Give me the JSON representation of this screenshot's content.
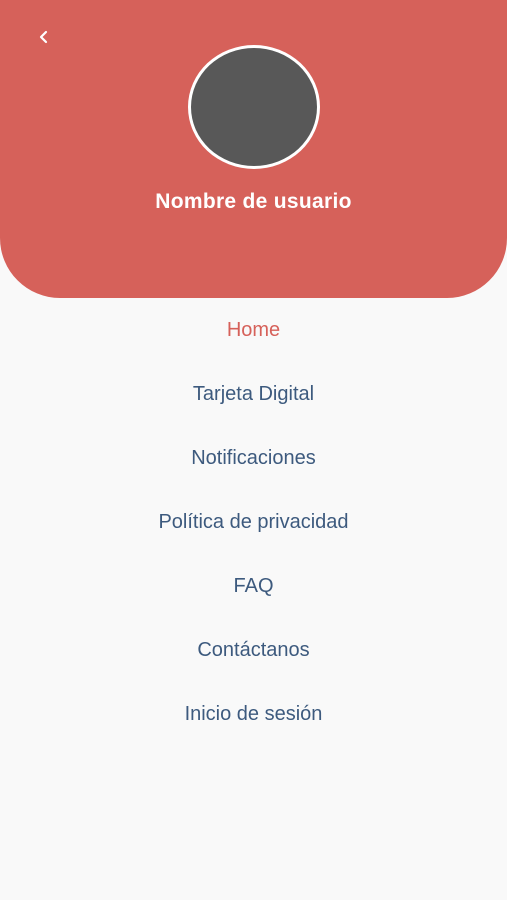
{
  "header": {
    "username": "Nombre de usuario",
    "back_icon": "chevron-left-icon",
    "colors": {
      "header_bg": "#d6615a",
      "avatar_bg": "#585858"
    }
  },
  "menu": {
    "items": [
      {
        "label": "Home",
        "active": true
      },
      {
        "label": "Tarjeta Digital",
        "active": false
      },
      {
        "label": "Notificaciones",
        "active": false
      },
      {
        "label": "Política de privacidad",
        "active": false
      },
      {
        "label": "FAQ",
        "active": false
      },
      {
        "label": "Contáctanos",
        "active": false
      },
      {
        "label": "Inicio de sesión",
        "active": false
      }
    ],
    "colors": {
      "active": "#d6615a",
      "inactive": "#3d5a7e"
    }
  }
}
